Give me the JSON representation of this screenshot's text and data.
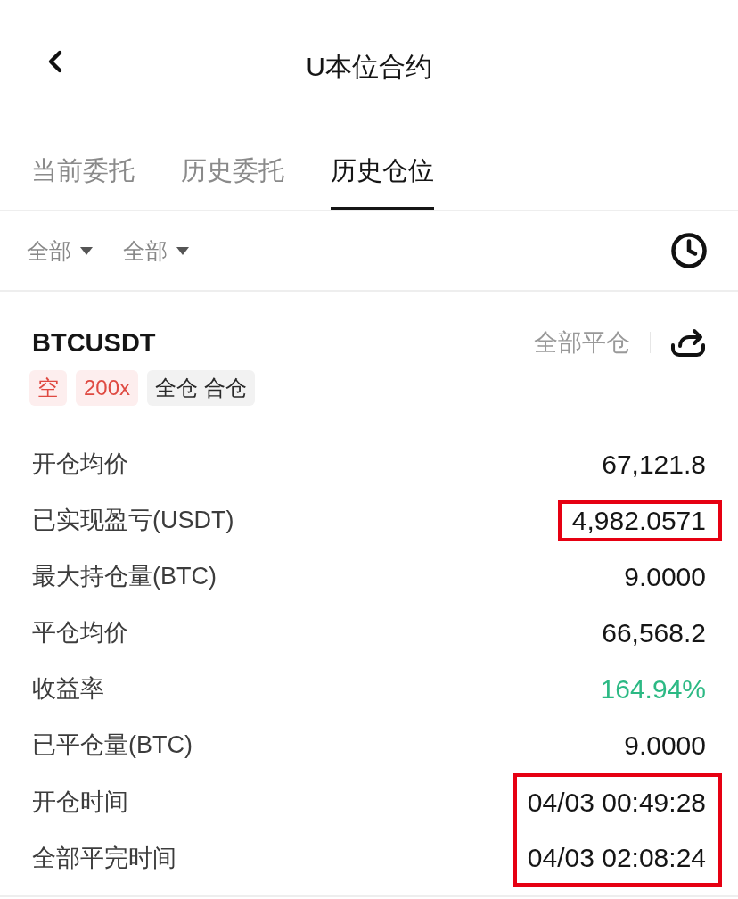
{
  "header": {
    "title": "U本位合约"
  },
  "tabs": [
    {
      "label": "当前委托",
      "selected": false
    },
    {
      "label": "历史委托",
      "selected": false
    },
    {
      "label": "历史仓位",
      "selected": true
    }
  ],
  "filters": [
    {
      "label": "全部"
    },
    {
      "label": "全部"
    }
  ],
  "position": {
    "symbol": "BTCUSDT",
    "close_all": "全部平仓",
    "tags": [
      {
        "label": "空",
        "kind": "side"
      },
      {
        "label": "200x",
        "kind": "leverage"
      },
      {
        "label": "全仓 合仓",
        "kind": "mode"
      }
    ],
    "details": [
      {
        "label": "开仓均价",
        "value": "67,121.8",
        "positive": false,
        "highlighted": false
      },
      {
        "label": "已实现盈亏(USDT)",
        "value": "4,982.0571",
        "positive": false,
        "highlighted": true
      },
      {
        "label": "最大持仓量(BTC)",
        "value": "9.0000",
        "positive": false,
        "highlighted": false
      },
      {
        "label": "平仓均价",
        "value": "66,568.2",
        "positive": false,
        "highlighted": false
      },
      {
        "label": "收益率",
        "value": "164.94%",
        "positive": true,
        "highlighted": false
      },
      {
        "label": "已平仓量(BTC)",
        "value": "9.0000",
        "positive": false,
        "highlighted": false
      },
      {
        "label": "开仓时间",
        "value": "04/03 00:49:28",
        "positive": false,
        "highlighted": true
      },
      {
        "label": "全部平完时间",
        "value": "04/03 02:08:24",
        "positive": false,
        "highlighted": true
      }
    ]
  }
}
